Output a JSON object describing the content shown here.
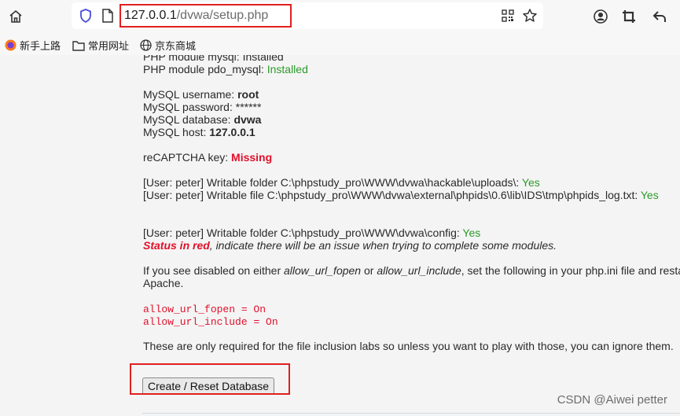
{
  "browser": {
    "url_host": "127.0.0.1",
    "url_path": "/dvwa/setup.php",
    "bookmarks": [
      "新手上路",
      "常用网址",
      "京东商城"
    ]
  },
  "content": {
    "line_mysql_partial": "PHP module mysql: Installed",
    "pdo_label": "PHP module pdo_mysql: ",
    "pdo_value": "Installed",
    "user_label": "MySQL username: ",
    "user_value": "root",
    "pass_label": "MySQL password: ******",
    "db_label": "MySQL database: ",
    "db_value": "dvwa",
    "host_label": "MySQL host: ",
    "host_value": "127.0.0.1",
    "recaptcha_label": "reCAPTCHA key: ",
    "recaptcha_value": "Missing",
    "uploads_label": "[User: peter] Writable folder C:\\phpstudy_pro\\WWW\\dvwa\\hackable\\uploads\\: ",
    "uploads_value": "Yes",
    "phpids_label": "[User: peter] Writable file C:\\phpstudy_pro\\WWW\\dvwa\\external\\phpids\\0.6\\lib\\IDS\\tmp\\phpids_log.txt: ",
    "phpids_value": "Yes",
    "config_label": "[User: peter] Writable folder C:\\phpstudy_pro\\WWW\\dvwa\\config: ",
    "config_value": "Yes",
    "status_red": "Status in red",
    "status_rest": ", indicate there will be an issue when trying to complete some modules.",
    "disabled_1": "If you see disabled on either ",
    "disabled_fopen": "allow_url_fopen",
    "disabled_2": " or ",
    "disabled_include": "allow_url_include",
    "disabled_3": ", set the following in your php.ini file and resta",
    "disabled_4": "Apache.",
    "code_1": "allow_url_fopen = On",
    "code_2": "allow_url_include = On",
    "only_required": "These are only required for the file inclusion labs so unless you want to play with those, you can ignore them.",
    "reset_button": "Create / Reset Database"
  },
  "watermark": "CSDN @Aiwei petter",
  "colors": {
    "ok": "#2a9a2a",
    "bad": "#e0102a",
    "highlight": "#e02020"
  }
}
